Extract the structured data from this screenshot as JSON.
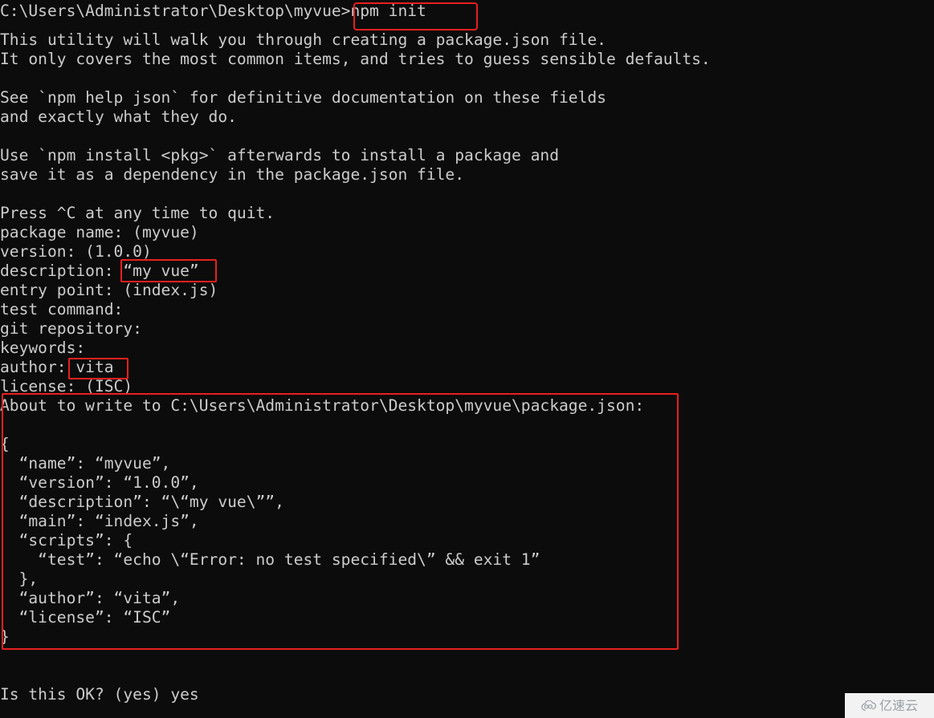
{
  "terminal": {
    "background_color": "#0c0c0c",
    "text_color": "#cccccc",
    "highlight_color": "#e8201f",
    "lines": [
      {
        "id": "prompt_command",
        "text": "C:\\Users\\Administrator\\Desktop\\myvue>npm init"
      },
      {
        "id": "intro_1",
        "text": "This utility will walk you through creating a package.json file."
      },
      {
        "id": "intro_2",
        "text": "It only covers the most common items, and tries to guess sensible defaults."
      },
      {
        "id": "blank_1",
        "text": ""
      },
      {
        "id": "help_1",
        "text": "See `npm help json` for definitive documentation on these fields"
      },
      {
        "id": "help_2",
        "text": "and exactly what they do."
      },
      {
        "id": "blank_2",
        "text": ""
      },
      {
        "id": "install_1",
        "text": "Use `npm install <pkg>` afterwards to install a package and"
      },
      {
        "id": "install_2",
        "text": "save it as a dependency in the package.json file."
      },
      {
        "id": "blank_3",
        "text": ""
      },
      {
        "id": "press_quit",
        "text": "Press ^C at any time to quit."
      },
      {
        "id": "prompt_package_name",
        "text": "package name: (myvue)"
      },
      {
        "id": "prompt_version",
        "text": "version: (1.0.0)"
      },
      {
        "id": "prompt_description",
        "text": "description: “my vue”"
      },
      {
        "id": "prompt_entry_point",
        "text": "entry point: (index.js)"
      },
      {
        "id": "prompt_test_command",
        "text": "test command:"
      },
      {
        "id": "prompt_git_repo",
        "text": "git repository:"
      },
      {
        "id": "prompt_keywords",
        "text": "keywords:"
      },
      {
        "id": "prompt_author",
        "text": "author: vita"
      },
      {
        "id": "prompt_license",
        "text": "license: (ISC)"
      },
      {
        "id": "about_to_write",
        "text": "About to write to C:\\Users\\Administrator\\Desktop\\myvue\\package.json:"
      },
      {
        "id": "blank_4",
        "text": ""
      },
      {
        "id": "json_open",
        "text": "{"
      },
      {
        "id": "json_name",
        "text": "  “name”: “myvue”,"
      },
      {
        "id": "json_version",
        "text": "  “version”: “1.0.0”,"
      },
      {
        "id": "json_description",
        "text": "  “description”: “\\“my vue\\””,"
      },
      {
        "id": "json_main",
        "text": "  “main”: “index.js”,"
      },
      {
        "id": "json_scripts_open",
        "text": "  “scripts”: {"
      },
      {
        "id": "json_scripts_test",
        "text": "    “test”: “echo \\“Error: no test specified\\” && exit 1”"
      },
      {
        "id": "json_scripts_close",
        "text": "  },"
      },
      {
        "id": "json_author",
        "text": "  “author”: “vita”,"
      },
      {
        "id": "json_license",
        "text": "  “license”: “ISC”"
      },
      {
        "id": "json_close",
        "text": "}"
      },
      {
        "id": "blank_5",
        "text": ""
      },
      {
        "id": "confirm_prompt",
        "text": "Is this OK? (yes) yes"
      }
    ],
    "highlights": [
      {
        "id": "highlight-npm-init",
        "label": "npm init"
      },
      {
        "id": "highlight-description",
        "label": "“my vue”"
      },
      {
        "id": "highlight-author",
        "label": "vita"
      },
      {
        "id": "highlight-json-block",
        "label": "package.json preview"
      }
    ]
  },
  "watermark": {
    "text": "亿速云",
    "icon": "cloud-icon",
    "background_color": "#f2f2f2",
    "text_color": "#9aa0a6"
  }
}
